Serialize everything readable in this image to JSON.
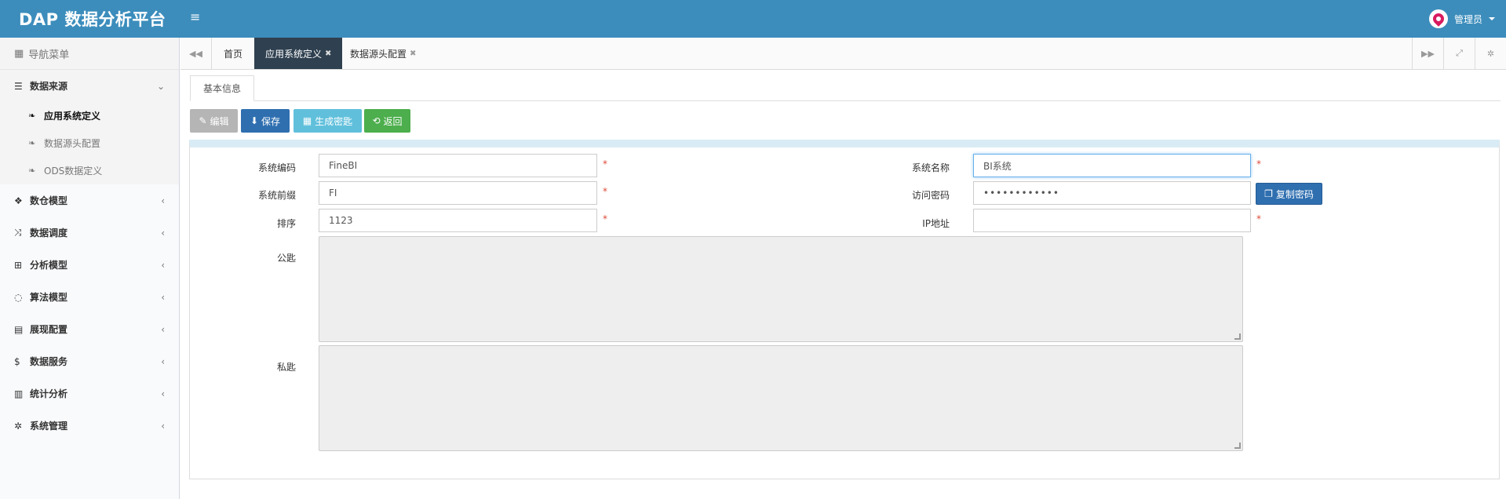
{
  "app": {
    "title": "DAP 数据分析平台",
    "user": "管理员"
  },
  "sidebar": {
    "header": "导航菜单",
    "groups": [
      {
        "label": "数据来源",
        "icon": "database-icon",
        "expanded": true,
        "children": [
          {
            "label": "应用系统定义",
            "active": true
          },
          {
            "label": "数据源头配置",
            "active": false
          },
          {
            "label": "ODS数据定义",
            "active": false
          }
        ]
      },
      {
        "label": "数仓模型",
        "icon": "cubes-icon"
      },
      {
        "label": "数据调度",
        "icon": "random-icon"
      },
      {
        "label": "分析模型",
        "icon": "sitemap-icon"
      },
      {
        "label": "算法模型",
        "icon": "spinner-icon"
      },
      {
        "label": "展现配置",
        "icon": "film-icon"
      },
      {
        "label": "数据服务",
        "icon": "dollar-icon"
      },
      {
        "label": "统计分析",
        "icon": "bar-chart-icon"
      },
      {
        "label": "系统管理",
        "icon": "gear-icon"
      }
    ]
  },
  "tabs": [
    {
      "label": "首页",
      "closable": false,
      "active": false
    },
    {
      "label": "应用系统定义",
      "closable": true,
      "active": true
    },
    {
      "label": "数据源头配置",
      "closable": true,
      "active": false
    }
  ],
  "form": {
    "tab": "基本信息",
    "buttons": {
      "edit": "编辑",
      "save": "保存",
      "generate_key": "生成密匙",
      "back": "返回"
    },
    "fields": {
      "system_code": {
        "label": "系统编码",
        "value": "FineBI",
        "required": true
      },
      "system_name": {
        "label": "系统名称",
        "value": "BI系统",
        "required": true
      },
      "system_prefix": {
        "label": "系统前缀",
        "value": "FI",
        "required": true
      },
      "access_password": {
        "label": "访问密码",
        "value": "••••••••••••"
      },
      "sort": {
        "label": "排序",
        "value": "1123",
        "required": true
      },
      "ip_address": {
        "label": "IP地址",
        "value": "",
        "required": true
      },
      "public_key": {
        "label": "公匙",
        "value": ""
      },
      "private_key": {
        "label": "私匙",
        "value": ""
      }
    },
    "copy_password_button": "复制密码",
    "required_mark": "*"
  },
  "colors": {
    "header": "#3c8dbc",
    "active_tab": "#2f4050",
    "primary": "#2f6fb0",
    "info": "#60c0dc",
    "success": "#4cae4c",
    "danger": "#dd4b39"
  }
}
